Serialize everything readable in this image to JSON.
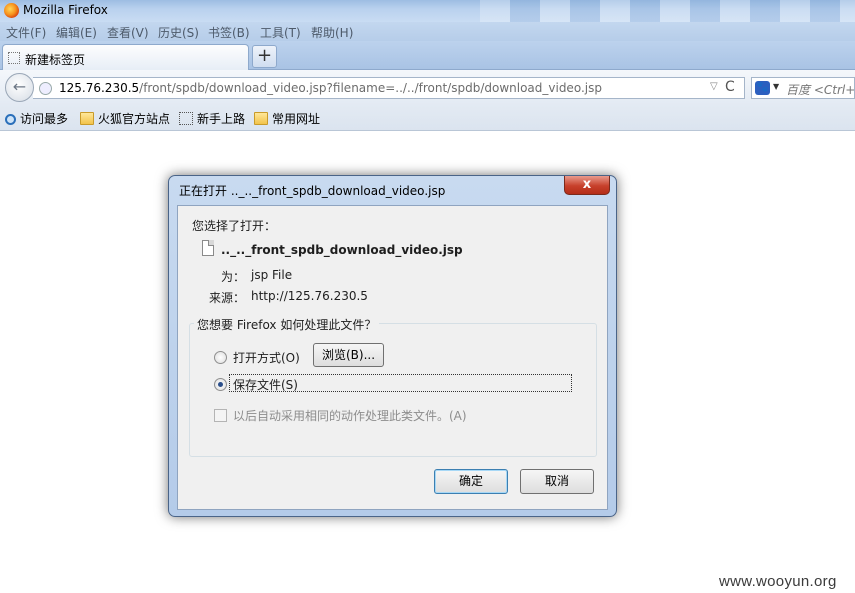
{
  "window": {
    "title": "Mozilla Firefox"
  },
  "menubar": {
    "items": [
      "文件(F)",
      "编辑(E)",
      "查看(V)",
      "历史(S)",
      "书签(B)",
      "工具(T)",
      "帮助(H)"
    ]
  },
  "tab": {
    "label": "新建标签页",
    "new_tab": "+"
  },
  "nav": {
    "back": "←",
    "url_host": "125.76.230.5",
    "url_path": "/front/spdb/download_video.jsp?filename=../../front/spdb/download_video.jsp",
    "dropdown": "▽",
    "reload": "C",
    "search_engine": "百度",
    "search_placeholder": "百度 <Ctrl+K>"
  },
  "bookmarks": [
    "访问最多",
    "火狐官方站点",
    "新手上路",
    "常用网址"
  ],
  "dialog": {
    "title": "正在打开 .._.._front_spdb_download_video.jsp",
    "close": "x",
    "prompt": "您选择了打开：",
    "filename": ".._.._front_spdb_download_video.jsp",
    "type_label": "为：",
    "type_value": "jsp File",
    "source_label": "来源：",
    "source_value": "http://125.76.230.5",
    "question": "您想要 Firefox 如何处理此文件？",
    "open_with_label": "打开方式(O)",
    "browse_label": "浏览(B)...",
    "save_label": "保存文件(S)",
    "remember_label": "以后自动采用相同的动作处理此类文件。(A)",
    "selected_action": "save",
    "ok_label": "确定",
    "cancel_label": "取消"
  },
  "watermark": "www.wooyun.org"
}
